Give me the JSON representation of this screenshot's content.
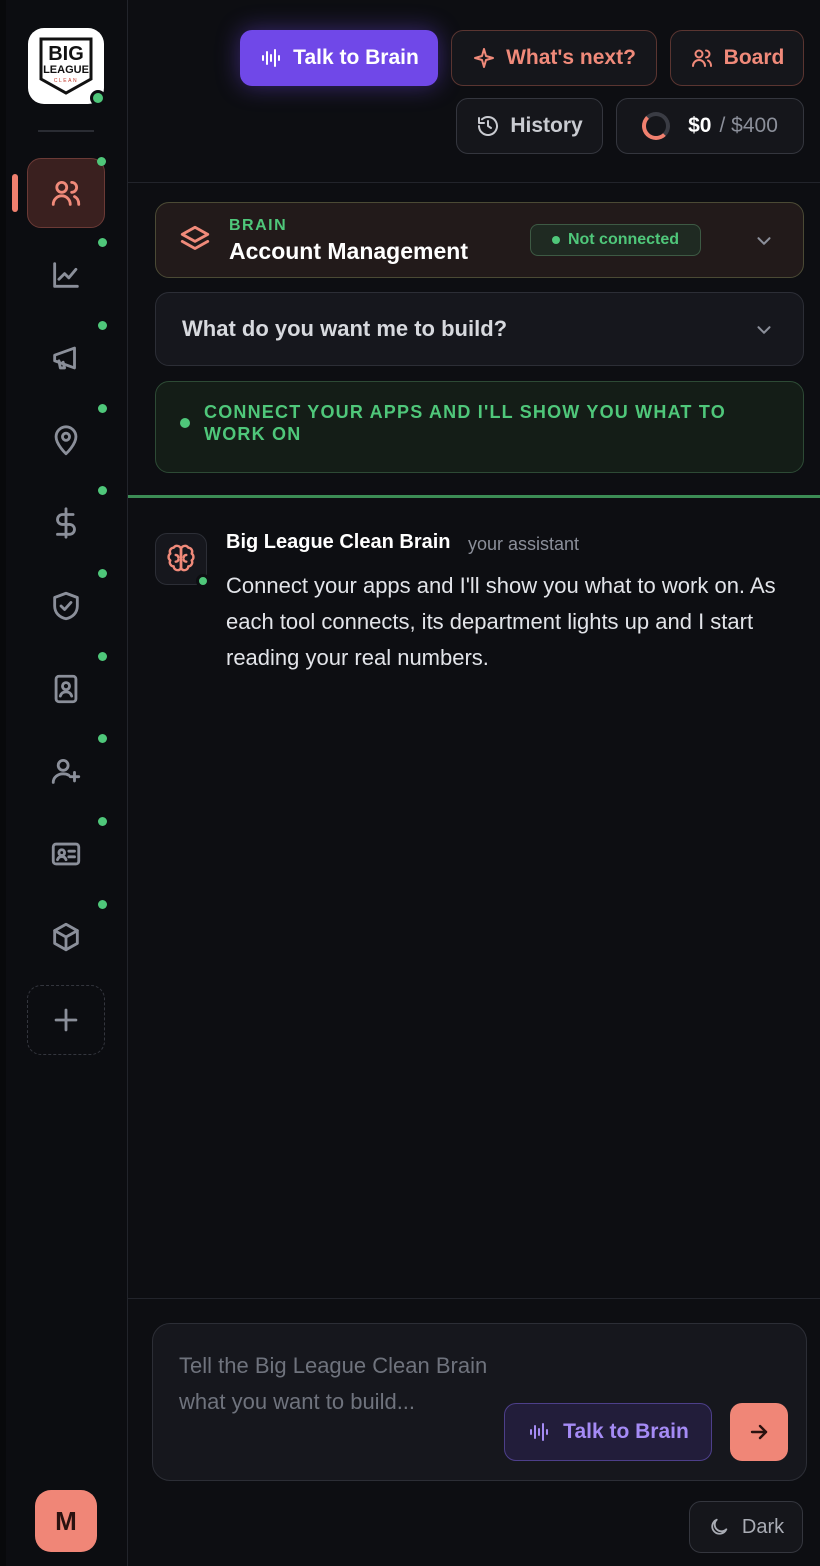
{
  "logo": {
    "line1": "BIG",
    "line2": "LEAGUE",
    "line3": "CLEAN"
  },
  "sidebar": {
    "items": [
      {
        "icon": "users-icon",
        "active": true
      },
      {
        "icon": "chart-line-icon"
      },
      {
        "icon": "megaphone-icon"
      },
      {
        "icon": "map-pin-icon"
      },
      {
        "icon": "dollar-icon"
      },
      {
        "icon": "shield-check-icon"
      },
      {
        "icon": "contact-book-icon"
      },
      {
        "icon": "user-plus-icon"
      },
      {
        "icon": "id-card-icon"
      },
      {
        "icon": "package-icon"
      }
    ],
    "add_icon": "plus-icon",
    "avatar_initial": "M"
  },
  "header": {
    "talk_label": "Talk to Brain",
    "next_label": "What's next?",
    "board_label": "Board",
    "history_label": "History",
    "budget_spent": "$0",
    "budget_total": "/ $400"
  },
  "brain_card": {
    "kicker": "BRAIN",
    "title": "Account Management",
    "status": "Not connected"
  },
  "build_card": {
    "label": "What do you want me to build?"
  },
  "connect_banner": {
    "text": "CONNECT YOUR APPS AND I'LL SHOW YOU WHAT TO WORK ON"
  },
  "message": {
    "author": "Big League Clean Brain",
    "role": "your assistant",
    "body": "Connect your apps and I'll show you what to work on. As each tool connects, its department lights up and I start reading your real numbers."
  },
  "composer": {
    "placeholder": "Tell the Big League Clean Brain what you want to build...",
    "talk_label": "Talk to Brain"
  },
  "theme_toggle": {
    "label": "Dark"
  },
  "colors": {
    "accent": "#f08677",
    "primary": "#7048e8",
    "success": "#4fc77a",
    "background": "#0d0e12"
  }
}
